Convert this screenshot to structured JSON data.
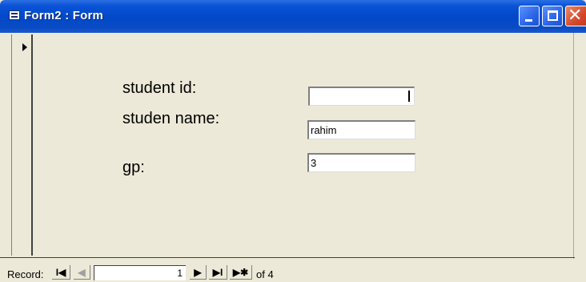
{
  "window": {
    "title": "Form2 : Form"
  },
  "form": {
    "fields": [
      {
        "label": "student id:",
        "value": ""
      },
      {
        "label": "studen name:",
        "value": "rahim"
      },
      {
        "label": "gp:",
        "value": "3"
      }
    ]
  },
  "navigation": {
    "record_label": "Record:",
    "current_record": "1",
    "total_text": "of  4",
    "first_glyph": "I◀",
    "prev_glyph": "◀",
    "next_glyph": "▶",
    "last_glyph": "▶I",
    "new_glyph": "▶✱"
  }
}
